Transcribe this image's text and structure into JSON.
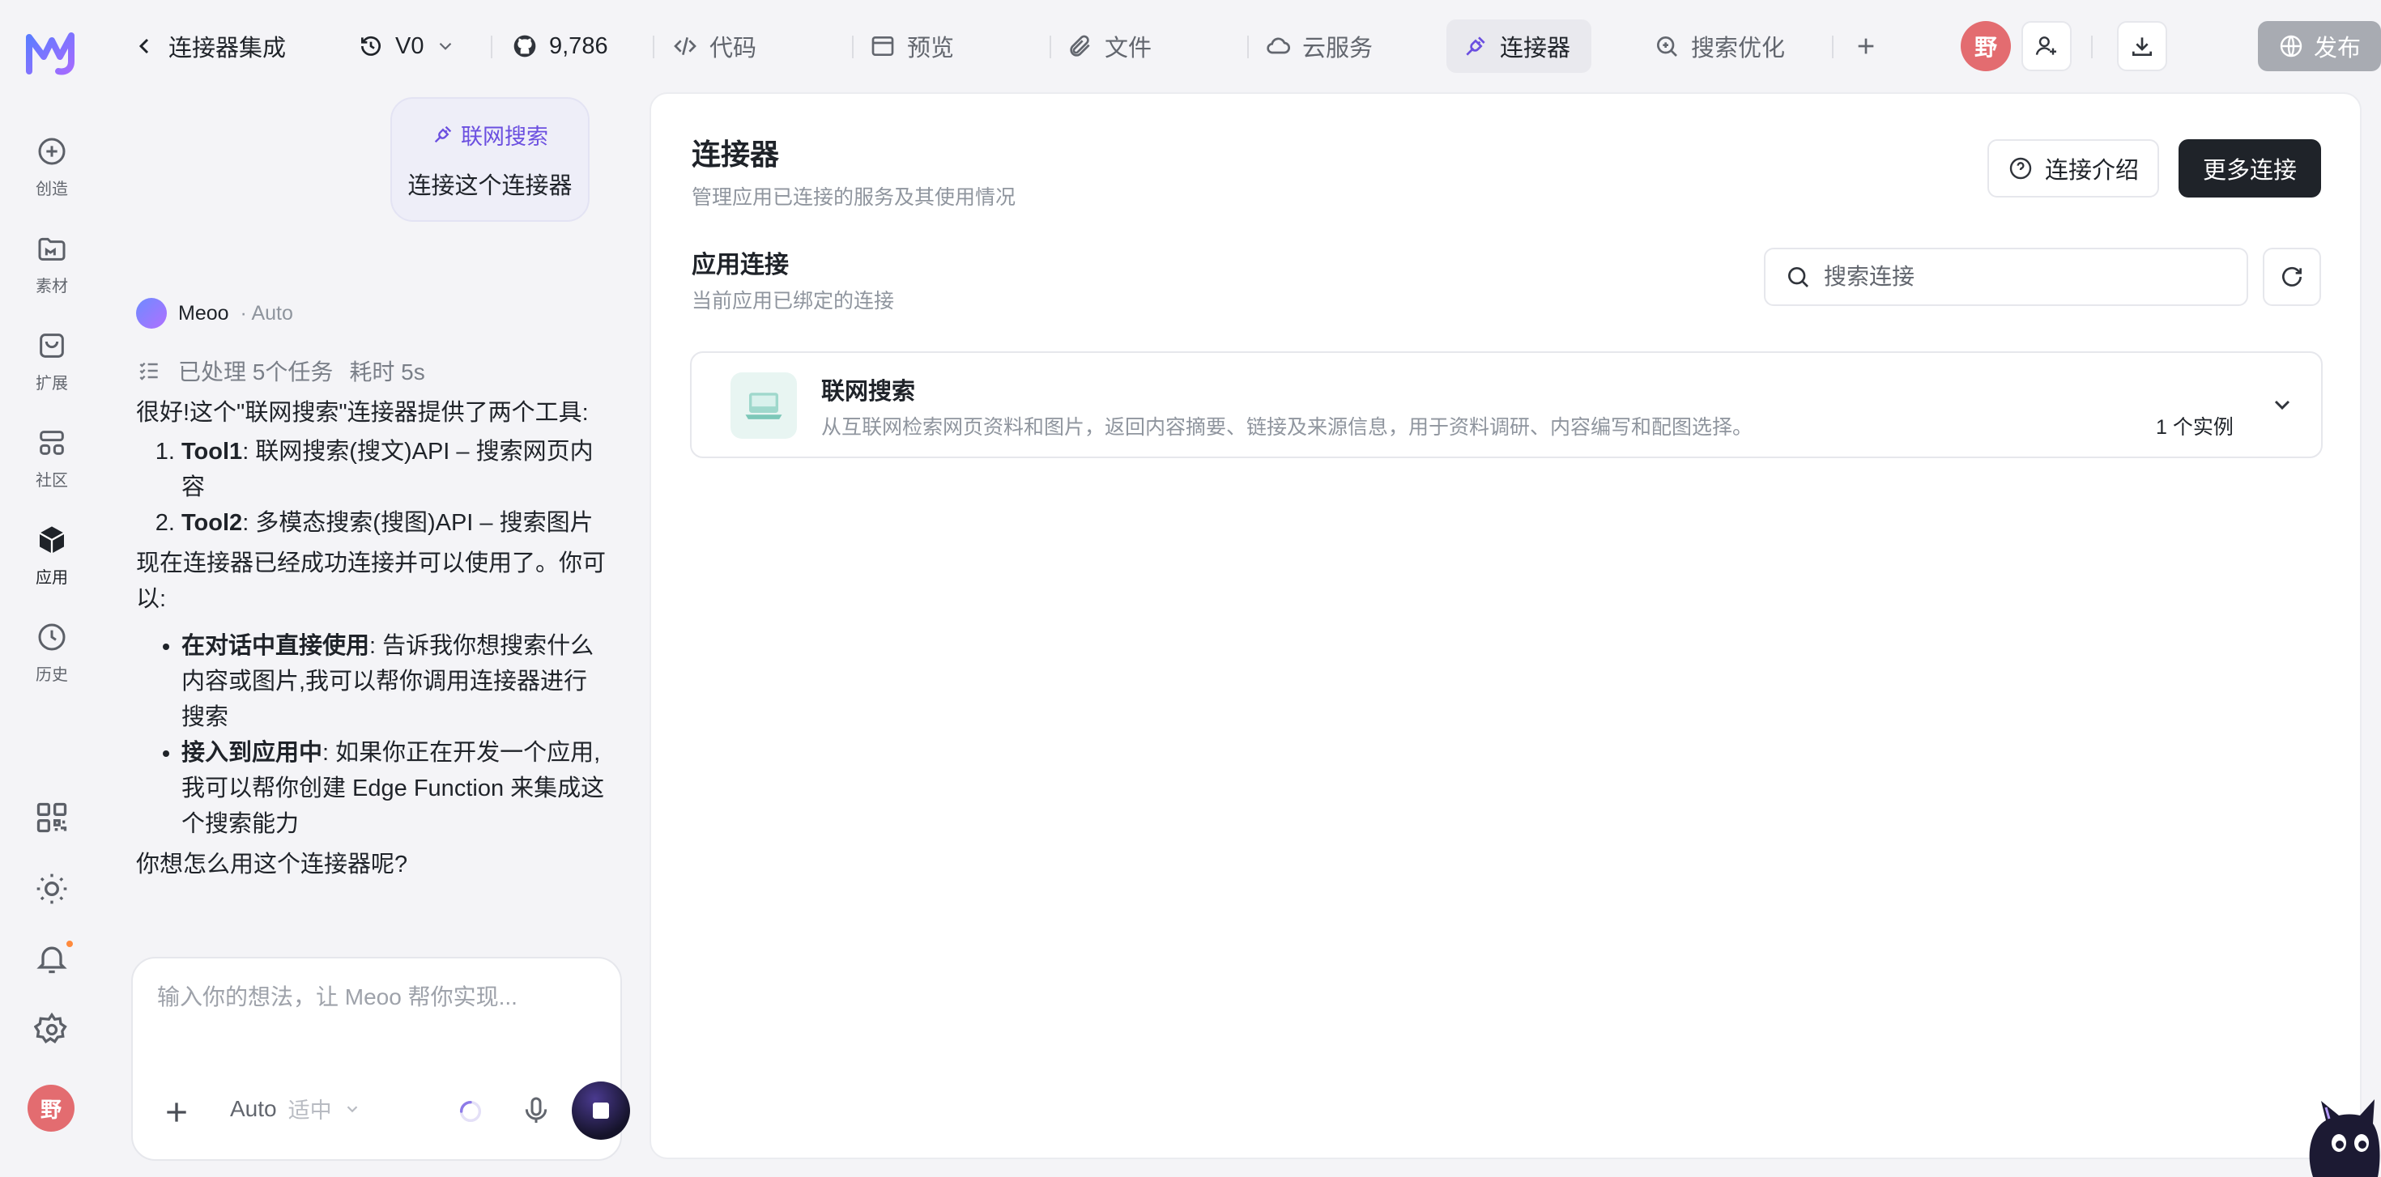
{
  "rail": {
    "items": [
      {
        "label": "创造",
        "icon": "plus-circle-icon"
      },
      {
        "label": "素材",
        "icon": "folder-icon"
      },
      {
        "label": "扩展",
        "icon": "bag-icon"
      },
      {
        "label": "社区",
        "icon": "grid-icon"
      },
      {
        "label": "应用",
        "icon": "cube-icon"
      },
      {
        "label": "历史",
        "icon": "clock-icon"
      }
    ],
    "avatar_text": "野"
  },
  "topbar": {
    "back_title": "连接器集成",
    "version": "V0",
    "stars": "9,786",
    "tabs": [
      {
        "label": "代码"
      },
      {
        "label": "预览"
      },
      {
        "label": "文件"
      },
      {
        "label": "云服务"
      },
      {
        "label": "连接器"
      },
      {
        "label": "搜索优化"
      }
    ],
    "avatar_text": "野",
    "publish_label": "发布"
  },
  "chat": {
    "user_chip": "联网搜索",
    "user_text": "连接这个连接器",
    "bot_name": "Meoo",
    "bot_mode": "· Auto",
    "task_summary": "已处理 5个任务",
    "task_time": "耗时 5s",
    "intro": "很好!这个\"联网搜索\"连接器提供了两个工具:",
    "tools": [
      {
        "name": "Tool1",
        "desc": ": 联网搜索(搜文)API – 搜索网页内容"
      },
      {
        "name": "Tool2",
        "desc": ": 多模态搜索(搜图)API – 搜索图片"
      }
    ],
    "status": "现在连接器已经成功连接并可以使用了。你可以:",
    "options": [
      {
        "name": "在对话中直接使用",
        "desc": ": 告诉我你想搜索什么内容或图片,我可以帮你调用连接器进行搜索"
      },
      {
        "name": "接入到应用中",
        "desc": ": 如果你正在开发一个应用,我可以帮你创建 Edge Function 来集成这个搜索能力"
      }
    ],
    "question": "你想怎么用这个连接器呢?",
    "input_placeholder": "输入你的想法，让 Meoo 帮你实现...",
    "model": "Auto",
    "model_sub": "适中"
  },
  "main": {
    "title": "连接器",
    "subtitle": "管理应用已连接的服务及其使用情况",
    "intro_button": "连接介绍",
    "more_button": "更多连接",
    "section_title": "应用连接",
    "section_subtitle": "当前应用已绑定的连接",
    "search_placeholder": "搜索连接",
    "connector": {
      "name": "联网搜索",
      "desc": "从互联网检索网页资料和图片，返回内容摘要、链接及来源信息，用于资料调研、内容编写和配图选择。",
      "count": "1 个实例"
    }
  },
  "colors": {
    "accent": "#7b61ff",
    "avatar": "#e36c70",
    "dark_button": "#1f2329"
  }
}
